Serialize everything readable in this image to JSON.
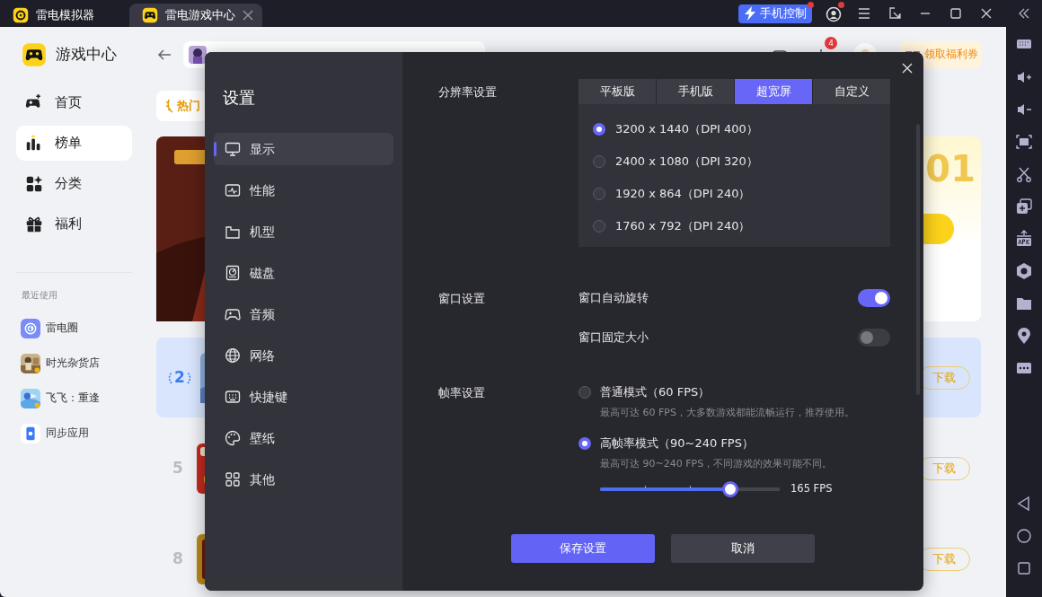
{
  "title_bar": {
    "tabs": [
      {
        "label": "雷电模拟器",
        "selected": false
      },
      {
        "label": "雷电游戏中心",
        "selected": true
      }
    ],
    "phone_control": {
      "label": "手机控制",
      "notification": true
    },
    "account_notification": true
  },
  "sidebar": {
    "title": "游戏中心",
    "items": [
      {
        "label": "首页",
        "selected": false
      },
      {
        "label": "榜单",
        "selected": true
      },
      {
        "label": "分类",
        "selected": false
      },
      {
        "label": "福利",
        "selected": false
      }
    ],
    "recent_title": "最近使用",
    "recent": [
      {
        "label": "雷电圈",
        "kind": "logo"
      },
      {
        "label": "时光杂货店",
        "kind": "picture"
      },
      {
        "label": "飞飞：重逢",
        "kind": "picture"
      },
      {
        "label": "同步应用",
        "kind": "logo"
      }
    ]
  },
  "header": {
    "notification_count": "4",
    "coupon": "领取福利券"
  },
  "content": {
    "tab": "热门",
    "banner_number": "01",
    "ranks": [
      {
        "rank": "2",
        "highlighted": true,
        "download": "下载"
      },
      {
        "rank": "5",
        "highlighted": false,
        "download": "下载"
      },
      {
        "rank": "8",
        "highlighted": false,
        "download": "下载"
      }
    ]
  },
  "settings": {
    "title": "设置",
    "nav": [
      {
        "label": "显示",
        "selected": true
      },
      {
        "label": "性能",
        "selected": false
      },
      {
        "label": "机型",
        "selected": false
      },
      {
        "label": "磁盘",
        "selected": false
      },
      {
        "label": "音频",
        "selected": false
      },
      {
        "label": "网络",
        "selected": false
      },
      {
        "label": "快捷键",
        "selected": false
      },
      {
        "label": "壁纸",
        "selected": false
      },
      {
        "label": "其他",
        "selected": false
      }
    ],
    "resolution": {
      "label": "分辨率设置",
      "tabs": [
        {
          "label": "平板版",
          "selected": false
        },
        {
          "label": "手机版",
          "selected": false
        },
        {
          "label": "超宽屏",
          "selected": true
        },
        {
          "label": "自定义",
          "selected": false
        }
      ],
      "options": [
        {
          "label": "3200 x 1440（DPI 400）",
          "selected": true
        },
        {
          "label": "2400 x 1080（DPI 320）",
          "selected": false
        },
        {
          "label": "1920 x 864（DPI 240）",
          "selected": false
        },
        {
          "label": "1760 x 792（DPI 240）",
          "selected": false
        }
      ]
    },
    "window": {
      "label": "窗口设置",
      "toggles": [
        {
          "label": "窗口自动旋转",
          "on": true
        },
        {
          "label": "窗口固定大小",
          "on": false
        }
      ]
    },
    "frame_rate": {
      "label": "帧率设置",
      "modes": [
        {
          "label": "普通模式（60 FPS）",
          "description": "最高可达 60 FPS，大多数游戏都能流畅运行，推荐使用。",
          "selected": false
        },
        {
          "label": "高帧率模式（90~240 FPS）",
          "description": "最高可达 90~240 FPS，不同游戏的效果可能不同。",
          "selected": true
        }
      ],
      "slider": {
        "level": 0.725,
        "reading": "165 FPS"
      }
    },
    "buttons": [
      {
        "label": "保存设置",
        "kind": "primary"
      },
      {
        "label": "取消",
        "kind": "secondary"
      }
    ]
  }
}
